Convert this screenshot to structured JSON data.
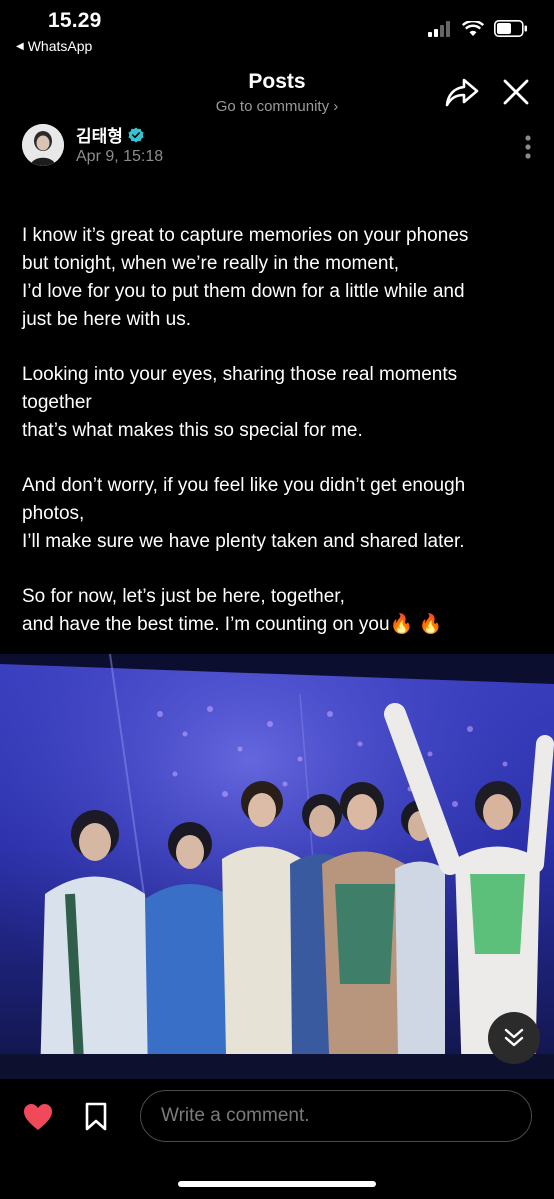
{
  "status_bar": {
    "time": "15.29",
    "back_app": "WhatsApp"
  },
  "header": {
    "title": "Posts",
    "subtitle": "Go to community ›"
  },
  "author": {
    "name": "김태형",
    "date": "Apr 9, 15:18"
  },
  "post": {
    "paragraphs": [
      [
        "I know it’s great to capture memories on your phones",
        "but tonight, when we’re really in the moment,",
        "I’d love for you to put them down for a little while and",
        "just be here with us."
      ],
      [
        "Looking into your eyes, sharing those real moments",
        "together",
        "that’s what makes this so special for me."
      ],
      [
        "And don’t worry, if you feel like you didn’t get enough",
        "photos,",
        "I’ll make sure we have plenty taken and shared later."
      ],
      [
        "So for now, let’s just be here, together,",
        "and have the best time. I’m counting on you🔥 🔥"
      ]
    ]
  },
  "comment": {
    "placeholder": "Write a comment."
  },
  "colors": {
    "background": "#000000",
    "heart": "#f04a5a",
    "verified": "#35c3d4",
    "muted": "#8d8d8d"
  },
  "icons": [
    "share-icon",
    "close-icon",
    "verified-icon",
    "more-vertical-icon",
    "heart-icon",
    "bookmark-icon",
    "double-chevron-down-icon",
    "signal-icon",
    "wifi-icon",
    "battery-icon"
  ]
}
